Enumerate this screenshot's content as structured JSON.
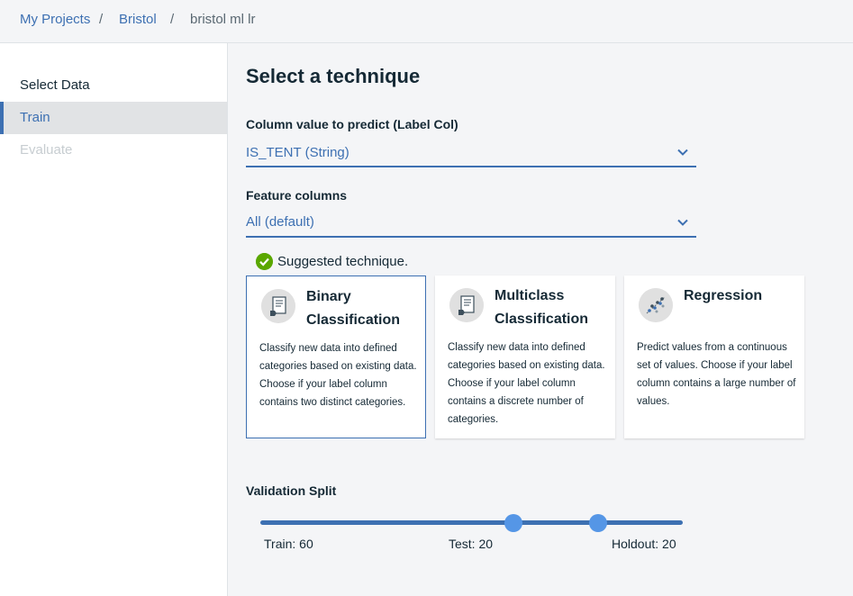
{
  "breadcrumb": {
    "items": [
      "My Projects",
      "Bristol"
    ],
    "separator": "/",
    "current": "bristol ml lr"
  },
  "sidebar": {
    "items": [
      {
        "label": "Select Data",
        "state": "normal"
      },
      {
        "label": "Train",
        "state": "active"
      },
      {
        "label": "Evaluate",
        "state": "disabled"
      }
    ]
  },
  "main": {
    "title": "Select a technique",
    "label_col": {
      "label": "Column value to predict (Label Col)",
      "value": "IS_TENT (String)",
      "icon": "chevron-down-icon"
    },
    "feature_cols": {
      "label": "Feature columns",
      "value": "All (default)",
      "icon": "chevron-down-icon"
    },
    "suggested": {
      "text": "Suggested technique.",
      "icon": "checkmark-icon"
    },
    "techniques": [
      {
        "title": "Binary Classification",
        "description": "Classify new data into defined categories based on existing data. Choose if your label column contains two distinct categories.",
        "icon": "document-tag-icon",
        "selected": true
      },
      {
        "title": "Multiclass Classification",
        "description": "Classify new data into defined categories based on existing data. Choose if your label column contains a discrete number of categories.",
        "icon": "document-tag-icon",
        "selected": false
      },
      {
        "title": "Regression",
        "description": "Predict values from a continuous set of values. Choose if your label column contains a large number of values.",
        "icon": "scatter-plot-icon",
        "selected": false
      }
    ],
    "validation_split": {
      "label": "Validation Split",
      "train": 60,
      "test": 20,
      "holdout": 20,
      "train_label": "Train: 60",
      "test_label": "Test: 20",
      "holdout_label": "Holdout: 20"
    }
  },
  "colors": {
    "accent": "#3d70b2",
    "thumb": "#5596e6",
    "success": "#5aa700"
  }
}
